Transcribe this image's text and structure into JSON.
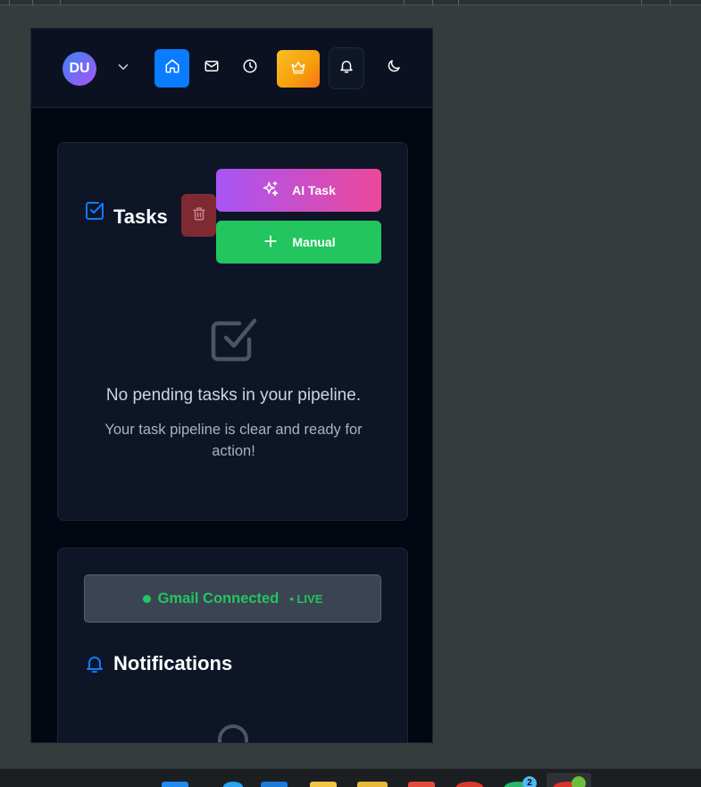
{
  "navbar": {
    "avatar_initials": "DU",
    "icons": {
      "chevron": "chevron-down-icon",
      "home": "home-icon",
      "mail": "mail-icon",
      "clock": "clock-icon",
      "crown": "crown-icon",
      "bell": "bell-icon",
      "theme": "moon-icon"
    }
  },
  "tasks": {
    "title": "Tasks",
    "ai_task_label": "AI Task",
    "manual_label": "Manual",
    "empty_title": "No pending tasks in your pipeline.",
    "empty_subtitle": "Your task pipeline is clear and ready for action!"
  },
  "notifications": {
    "gmail_status": "Gmail Connected",
    "live_label": "• LIVE",
    "title": "Notifications"
  },
  "taskbar": {
    "badge_count": "2"
  },
  "colors": {
    "accent_blue": "#0a7cff",
    "success_green": "#22c55e",
    "ai_gradient_start": "#a855f7",
    "ai_gradient_end": "#ec4899",
    "premium_gradient_start": "#f59e0b",
    "danger": "#7f2a33"
  }
}
